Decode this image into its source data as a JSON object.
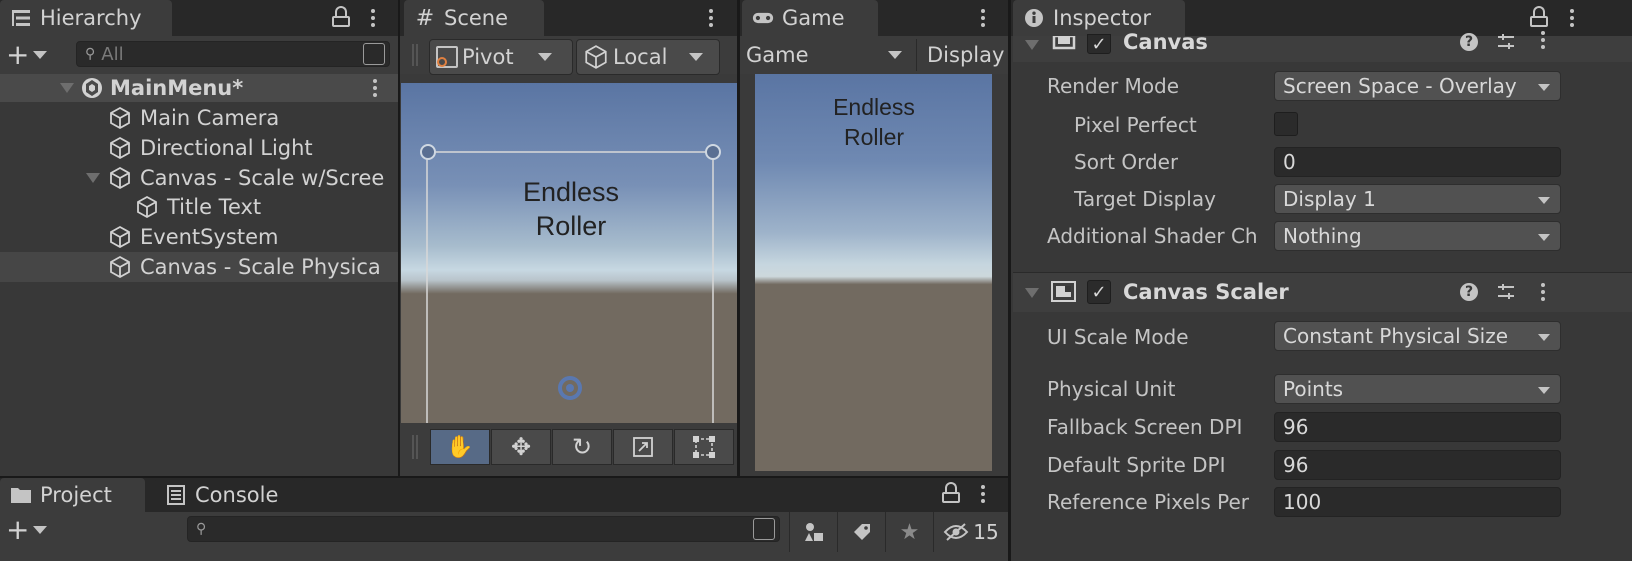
{
  "hierarchy": {
    "tab_label": "Hierarchy",
    "search_placeholder": "All",
    "scene_name": "MainMenu*",
    "items": [
      {
        "label": "Main Camera"
      },
      {
        "label": "Directional Light"
      },
      {
        "label": "Canvas - Scale w/Scree"
      },
      {
        "label": "Title Text"
      },
      {
        "label": "EventSystem"
      },
      {
        "label": "Canvas - Scale Physica"
      }
    ]
  },
  "scene": {
    "tab_label": "Scene",
    "pivot_label": "Pivot",
    "local_label": "Local",
    "title_text": "Endless Roller",
    "tools": [
      "hand-tool",
      "move-tool",
      "rotate-tool",
      "scale-tool",
      "rect-tool"
    ]
  },
  "game": {
    "tab_label": "Game",
    "display_mode": "Game",
    "display_label": "Display",
    "title_text": "Endless Roller"
  },
  "inspector": {
    "tab_label": "Inspector",
    "canvas": {
      "title": "Canvas",
      "enabled": true,
      "render_mode_label": "Render Mode",
      "render_mode_value": "Screen Space - Overlay",
      "pixel_perfect_label": "Pixel Perfect",
      "pixel_perfect": false,
      "sort_order_label": "Sort Order",
      "sort_order_value": "0",
      "target_display_label": "Target Display",
      "target_display_value": "Display 1",
      "shader_channels_label": "Additional Shader Ch",
      "shader_channels_value": "Nothing"
    },
    "canvas_scaler": {
      "title": "Canvas Scaler",
      "enabled": true,
      "ui_scale_mode_label": "UI Scale Mode",
      "ui_scale_mode_value": "Constant Physical Size",
      "physical_unit_label": "Physical Unit",
      "physical_unit_value": "Points",
      "fallback_dpi_label": "Fallback Screen DPI",
      "fallback_dpi_value": "96",
      "sprite_dpi_label": "Default Sprite DPI",
      "sprite_dpi_value": "96",
      "ref_pixels_label": "Reference Pixels Per",
      "ref_pixels_value": "100"
    }
  },
  "bottom": {
    "project_tab": "Project",
    "console_tab": "Console",
    "hidden_count": "15"
  },
  "colors": {
    "panel": "#383838",
    "tabbar": "#282828",
    "selected_row": "#4a4a4a",
    "sky_top": "#5a75a3",
    "horizon": "#c7d8e2",
    "ground": "#726a60"
  }
}
